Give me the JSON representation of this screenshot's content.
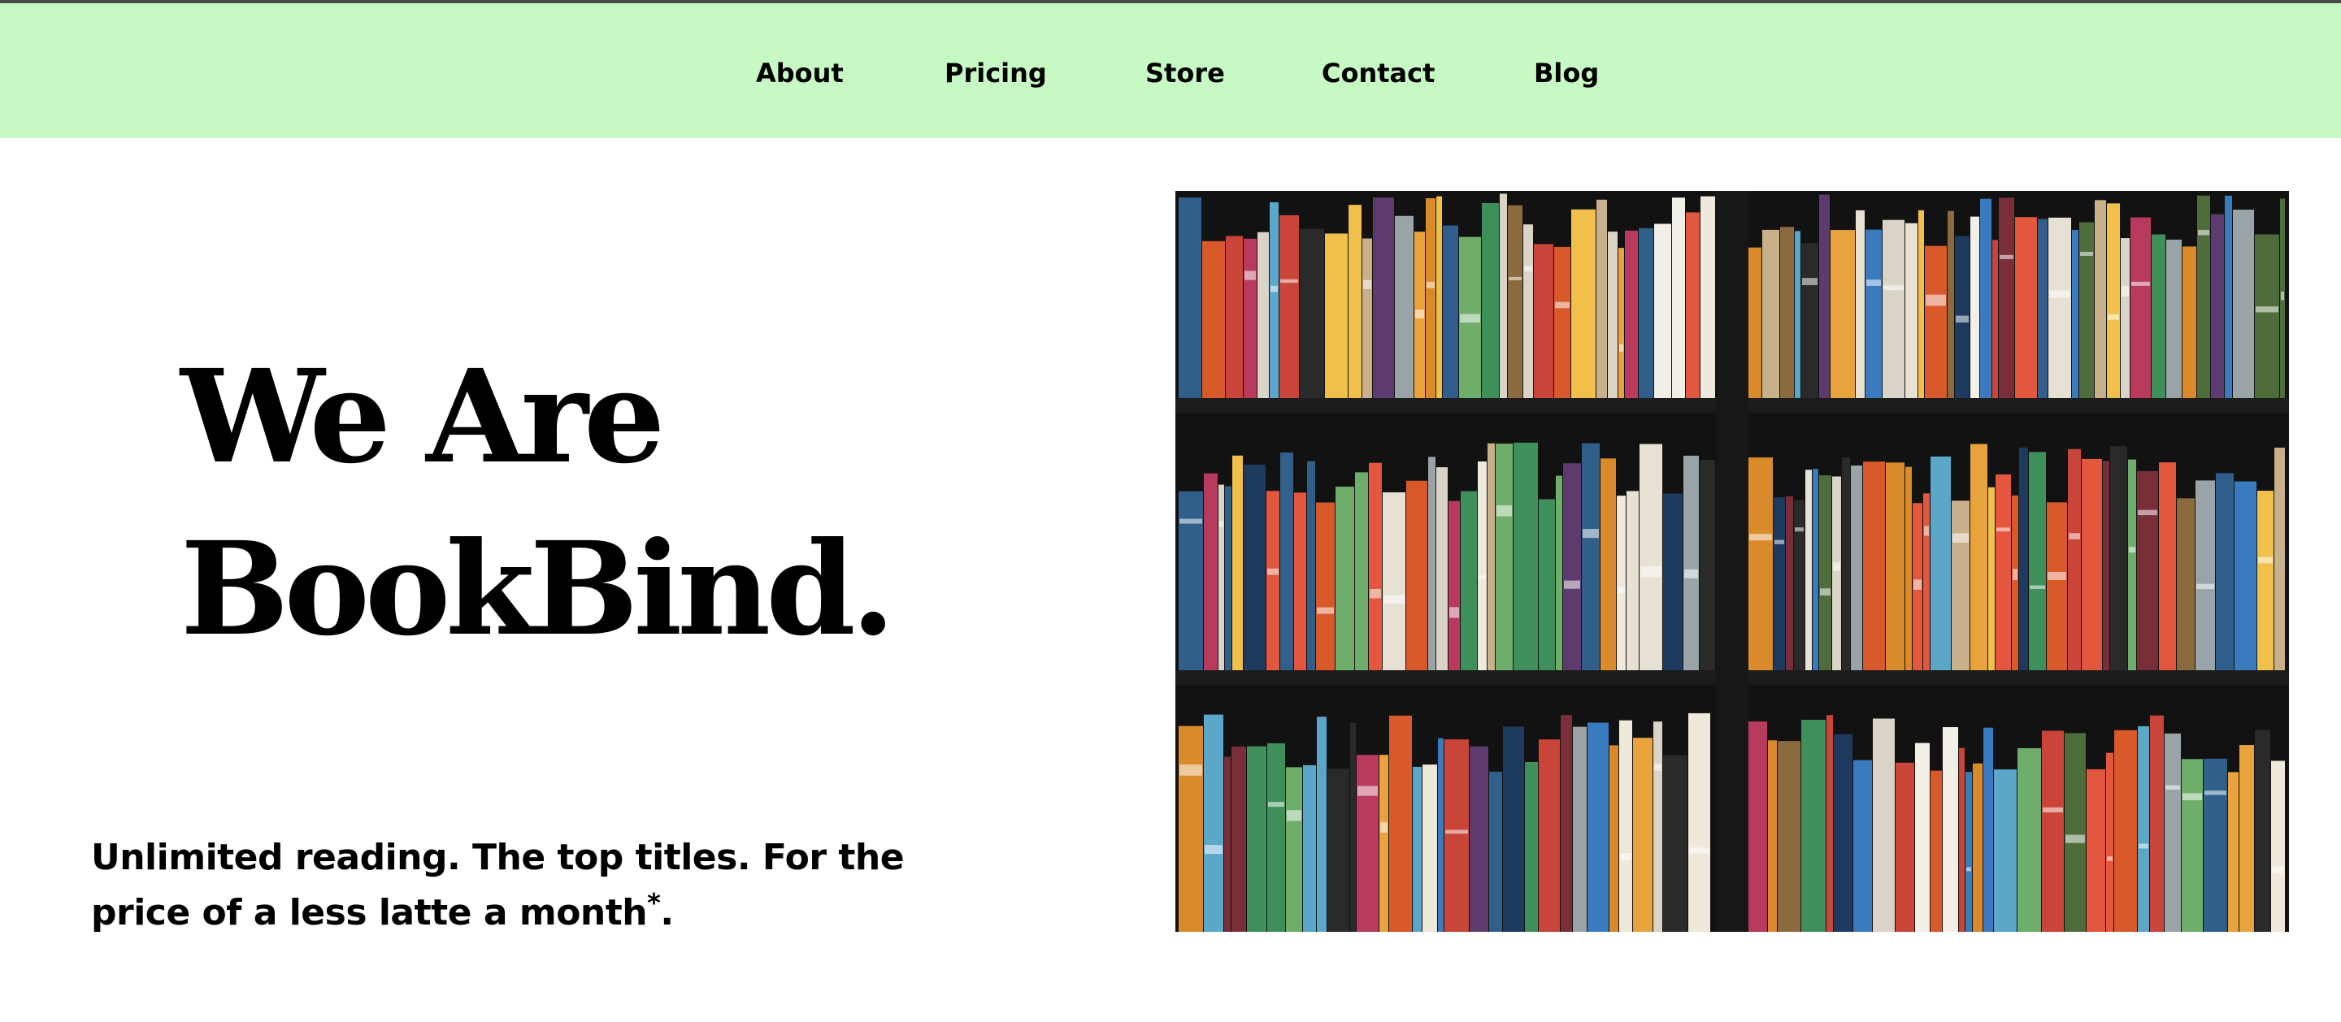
{
  "nav": {
    "items": [
      {
        "label": "About"
      },
      {
        "label": "Pricing"
      },
      {
        "label": "Store"
      },
      {
        "label": "Contact"
      },
      {
        "label": "Blog"
      }
    ]
  },
  "hero": {
    "title_line1": "We Are",
    "title_line2": "BookBind.",
    "tagline_text": "Unlimited reading. The top titles. For the price of a less latte a month",
    "tagline_mark": "*",
    "tagline_end": "."
  },
  "colors": {
    "nav_background": "#c7f9c4",
    "top_border": "#4b4b4b",
    "text": "#000000",
    "shelf": "#161616"
  }
}
